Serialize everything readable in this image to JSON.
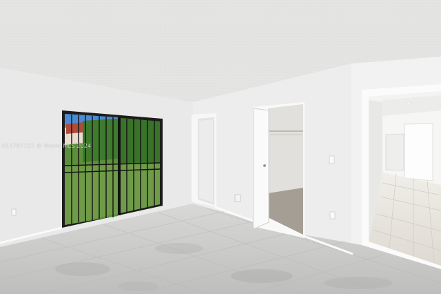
{
  "photo": {
    "watermark": "A11707721 © Miami MLS 2024"
  },
  "colors": {
    "wall": "#ebebeb",
    "ceiling": "#e6e6e4",
    "floor": "#cfcfcd",
    "trim": "#f5f5f5",
    "door_frame": "#1a1a1a",
    "grass": "#6f9a48",
    "foliage": "#3f7a2e",
    "sky": "#4a8ad6",
    "closet_floor": "#a49e94"
  }
}
